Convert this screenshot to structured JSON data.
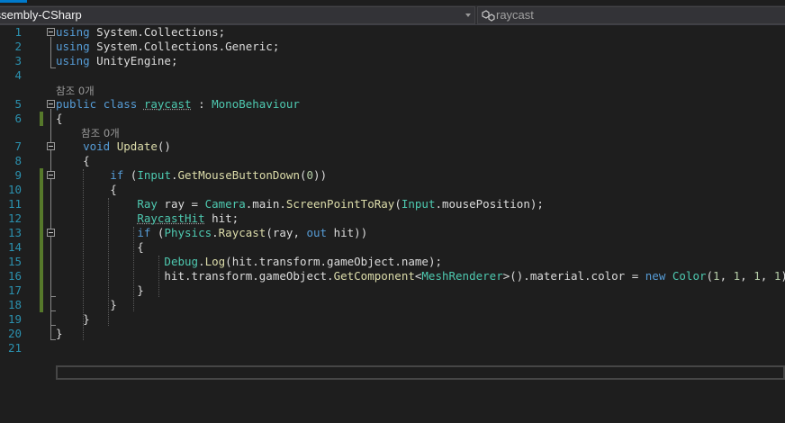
{
  "navbar": {
    "project": "Assembly-CSharp",
    "member": "raycast",
    "member_icon": "class-icon"
  },
  "code_lens": {
    "class_refs": "참조 0개",
    "method_refs": "참조 0개"
  },
  "line_numbers": [
    "1",
    "2",
    "3",
    "4",
    "5",
    "6",
    "7",
    "8",
    "9",
    "10",
    "11",
    "12",
    "13",
    "14",
    "15",
    "16",
    "17",
    "18",
    "19",
    "20",
    "21"
  ],
  "code_lines": [
    [
      [
        "kw",
        "using"
      ],
      [
        "p",
        " System.Collections;"
      ]
    ],
    [
      [
        "kw",
        "using"
      ],
      [
        "p",
        " System.Collections.Generic;"
      ]
    ],
    [
      [
        "kw",
        "using"
      ],
      [
        "p",
        " UnityEngine;"
      ]
    ],
    [],
    [
      [
        "kw",
        "public"
      ],
      [
        "p",
        " "
      ],
      [
        "kw",
        "class"
      ],
      [
        "p",
        " "
      ],
      [
        "ty squig",
        "raycast"
      ],
      [
        "p",
        " : "
      ],
      [
        "ty",
        "MonoBehaviour"
      ]
    ],
    [
      [
        "p",
        "{"
      ]
    ],
    [
      [
        "p",
        "    "
      ],
      [
        "kw",
        "void"
      ],
      [
        "p",
        " "
      ],
      [
        "mt",
        "Update"
      ],
      [
        "p",
        "()"
      ]
    ],
    [
      [
        "p",
        "    {"
      ]
    ],
    [
      [
        "p",
        "        "
      ],
      [
        "kw",
        "if"
      ],
      [
        "p",
        " ("
      ],
      [
        "ty",
        "Input"
      ],
      [
        "p",
        "."
      ],
      [
        "mt",
        "GetMouseButtonDown"
      ],
      [
        "p",
        "("
      ],
      [
        "nm",
        "0"
      ],
      [
        "p",
        "))"
      ]
    ],
    [
      [
        "p",
        "        {"
      ]
    ],
    [
      [
        "p",
        "            "
      ],
      [
        "ty",
        "Ray"
      ],
      [
        "p",
        " ray = "
      ],
      [
        "ty",
        "Camera"
      ],
      [
        "p",
        ".main."
      ],
      [
        "mt",
        "ScreenPointToRay"
      ],
      [
        "p",
        "("
      ],
      [
        "ty",
        "Input"
      ],
      [
        "p",
        ".mousePosition);"
      ]
    ],
    [
      [
        "p",
        "            "
      ],
      [
        "ty squig",
        "RaycastHit"
      ],
      [
        "p",
        " hit;"
      ]
    ],
    [
      [
        "p",
        "            "
      ],
      [
        "kw",
        "if"
      ],
      [
        "p",
        " ("
      ],
      [
        "ty",
        "Physics"
      ],
      [
        "p",
        "."
      ],
      [
        "mt",
        "Raycast"
      ],
      [
        "p",
        "(ray, "
      ],
      [
        "kw",
        "out"
      ],
      [
        "p",
        " hit))"
      ]
    ],
    [
      [
        "p",
        "            {"
      ]
    ],
    [
      [
        "p",
        "                "
      ],
      [
        "ty",
        "Debug"
      ],
      [
        "p",
        "."
      ],
      [
        "mt",
        "Log"
      ],
      [
        "p",
        "(hit.transform.gameObject.name);"
      ]
    ],
    [
      [
        "p",
        "                hit.transform.gameObject."
      ],
      [
        "mt",
        "GetComponent"
      ],
      [
        "p",
        "<"
      ],
      [
        "ty",
        "MeshRenderer"
      ],
      [
        "p",
        ">().material.color = "
      ],
      [
        "kw",
        "new"
      ],
      [
        "p",
        " "
      ],
      [
        "ty",
        "Color"
      ],
      [
        "p",
        "("
      ],
      [
        "nm",
        "1"
      ],
      [
        "p",
        ", "
      ],
      [
        "nm",
        "1"
      ],
      [
        "p",
        ", "
      ],
      [
        "nm",
        "1"
      ],
      [
        "p",
        ", "
      ],
      [
        "nm",
        "1"
      ],
      [
        "p",
        ");"
      ]
    ],
    [
      [
        "p",
        "            }"
      ]
    ],
    [
      [
        "p",
        "        }"
      ]
    ],
    [
      [
        "p",
        "    }"
      ]
    ],
    [
      [
        "p",
        "}"
      ]
    ],
    []
  ]
}
